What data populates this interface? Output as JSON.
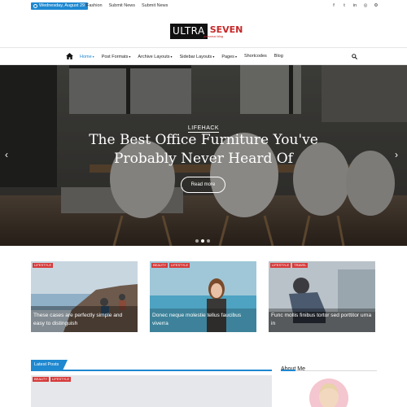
{
  "topbar": {
    "date": "Wednesday, August 29",
    "links": [
      "Fashion",
      "Submit News",
      "Submit News"
    ],
    "socials": [
      "facebook-icon",
      "twitter-icon",
      "linkedin-icon",
      "instagram-icon",
      "settings-icon"
    ]
  },
  "logo": {
    "part1": "ULTRA",
    "part2": "SEVEN",
    "tagline": "personal blog"
  },
  "nav": {
    "items": [
      {
        "label": "Home",
        "dropdown": true,
        "active": true
      },
      {
        "label": "Post Formats",
        "dropdown": true
      },
      {
        "label": "Archive Layouts",
        "dropdown": true
      },
      {
        "label": "Sidebar Layouts",
        "dropdown": true
      },
      {
        "label": "Pages",
        "dropdown": true
      },
      {
        "label": "Shortcodes",
        "dropdown": false
      },
      {
        "label": "Blog",
        "dropdown": false
      }
    ],
    "caret": "▾"
  },
  "hero": {
    "category": "LIFEHACK",
    "title": "The Best Office Furniture You've Probably Never Heard Of",
    "button": "Read more",
    "prev": "‹",
    "next": "›",
    "slide_count": 3,
    "active_slide": 2
  },
  "cards": [
    {
      "tags": [
        "LIFESTYLE"
      ],
      "title": "These cases are perfectly simple and easy to distinguish"
    },
    {
      "tags": [
        "BEAUTY",
        "LIFESTYLE"
      ],
      "title": "Donec neque molestie tellus faucibus viverra"
    },
    {
      "tags": [
        "LIFESTYLE",
        "TRAVEL"
      ],
      "title": "Func mollis finibus tortor sed porttitor urna in"
    }
  ],
  "latest": {
    "label": "Latest Posts",
    "tags": [
      "BEAUTY",
      "LIFESTYLE"
    ]
  },
  "about": {
    "label": "About Me"
  },
  "colors": {
    "accent": "#1e88d0",
    "tag": "#d63a3a",
    "logo_red": "#c62828"
  }
}
